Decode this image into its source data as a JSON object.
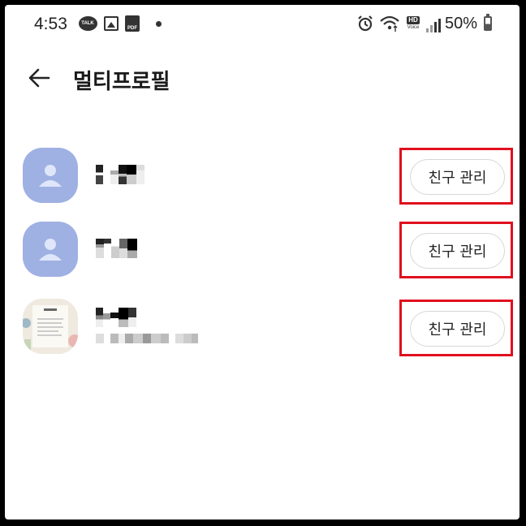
{
  "status_bar": {
    "time": "4:53",
    "talk_badge": "TALK",
    "pdf_badge": "PDF",
    "hd_badge": "HD",
    "voice_label": "Voice",
    "battery": "50%"
  },
  "header": {
    "title": "멀티프로필"
  },
  "profiles": [
    {
      "manage_label": "친구 관리",
      "avatar": "default"
    },
    {
      "manage_label": "친구 관리",
      "avatar": "default"
    },
    {
      "manage_label": "친구 관리",
      "avatar": "photo"
    }
  ],
  "colors": {
    "avatar_default": "#9fb1e3",
    "highlight": "#e0101e",
    "button_border": "#d7d7d7"
  },
  "icons": [
    "talk-icon",
    "gallery-icon",
    "pdf-icon",
    "alarm-icon",
    "wifi-icon",
    "signal-icon",
    "battery-icon",
    "back-arrow-icon",
    "person-icon"
  ]
}
